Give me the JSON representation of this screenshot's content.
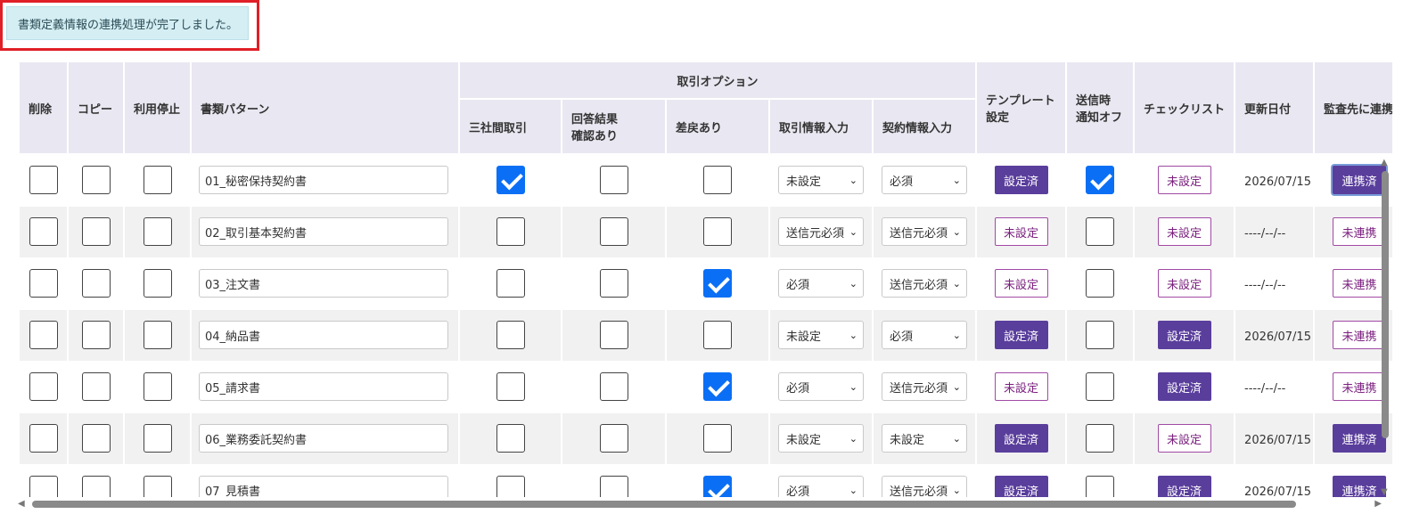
{
  "notice": {
    "message": "書類定義情報の連携処理が完了しました。"
  },
  "table": {
    "headers": {
      "delete": "削除",
      "copy": "コピー",
      "suspend": "利用停止",
      "doc_pattern": "書類パターン",
      "trade_options": "取引オプション",
      "three_party": "三社間取引",
      "answer_confirm_line1": "回答結果",
      "answer_confirm_line2": "確認あり",
      "sendback": "差戻あり",
      "trade_info_input": "取引情報入力",
      "contract_info_input": "契約情報入力",
      "template_line1": "テンプレート",
      "template_line2": "設定",
      "notify_off_line1": "送信時",
      "notify_off_line2": "通知オフ",
      "checklist": "チェックリスト",
      "updated": "更新日付",
      "audit_link": "監査先に連携"
    },
    "rows": [
      {
        "pattern": "01_秘密保持契約書",
        "delete": false,
        "copy": false,
        "suspend": false,
        "three_party": true,
        "answer_confirm": false,
        "sendback": false,
        "trade_info": "未設定",
        "contract_info": "必須",
        "template": "設定済",
        "template_set": true,
        "notify_off": true,
        "checklist": "未設定",
        "checklist_set": false,
        "updated": "2026/07/15",
        "audit": "連携済",
        "audit_set": true
      },
      {
        "pattern": "02_取引基本契約書",
        "delete": false,
        "copy": false,
        "suspend": false,
        "three_party": false,
        "answer_confirm": false,
        "sendback": false,
        "trade_info": "送信元必須",
        "contract_info": "送信元必須",
        "template": "未設定",
        "template_set": false,
        "notify_off": false,
        "checklist": "未設定",
        "checklist_set": false,
        "updated": "----/--/--",
        "audit": "未連携",
        "audit_set": false
      },
      {
        "pattern": "03_注文書",
        "delete": false,
        "copy": false,
        "suspend": false,
        "three_party": false,
        "answer_confirm": false,
        "sendback": true,
        "trade_info": "必須",
        "contract_info": "送信元必須",
        "template": "未設定",
        "template_set": false,
        "notify_off": false,
        "checklist": "未設定",
        "checklist_set": false,
        "updated": "----/--/--",
        "audit": "未連携",
        "audit_set": false
      },
      {
        "pattern": "04_納品書",
        "delete": false,
        "copy": false,
        "suspend": false,
        "three_party": false,
        "answer_confirm": false,
        "sendback": false,
        "trade_info": "未設定",
        "contract_info": "必須",
        "template": "設定済",
        "template_set": true,
        "notify_off": false,
        "checklist": "設定済",
        "checklist_set": true,
        "updated": "2026/07/15",
        "audit": "未連携",
        "audit_set": false
      },
      {
        "pattern": "05_請求書",
        "delete": false,
        "copy": false,
        "suspend": false,
        "three_party": false,
        "answer_confirm": false,
        "sendback": true,
        "trade_info": "必須",
        "contract_info": "送信元必須",
        "template": "未設定",
        "template_set": false,
        "notify_off": false,
        "checklist": "設定済",
        "checklist_set": true,
        "updated": "----/--/--",
        "audit": "未連携",
        "audit_set": false
      },
      {
        "pattern": "06_業務委託契約書",
        "delete": false,
        "copy": false,
        "suspend": false,
        "three_party": false,
        "answer_confirm": false,
        "sendback": false,
        "trade_info": "未設定",
        "contract_info": "未設定",
        "template": "設定済",
        "template_set": true,
        "notify_off": false,
        "checklist": "未設定",
        "checklist_set": false,
        "updated": "2026/07/15",
        "audit": "連携済",
        "audit_set": true
      },
      {
        "pattern": "07_見積書",
        "delete": false,
        "copy": false,
        "suspend": false,
        "three_party": false,
        "answer_confirm": false,
        "sendback": true,
        "trade_info": "必須",
        "contract_info": "送信元必須",
        "template": "設定済",
        "template_set": true,
        "notify_off": false,
        "checklist": "設定済",
        "checklist_set": true,
        "updated": "2026/07/15",
        "audit": "連携済",
        "audit_set": true
      }
    ]
  },
  "colors": {
    "accent": "#5a3e9c",
    "check": "#0b6ff5",
    "notice_bg": "#d4eef3",
    "highlight_border": "#e01f26"
  }
}
